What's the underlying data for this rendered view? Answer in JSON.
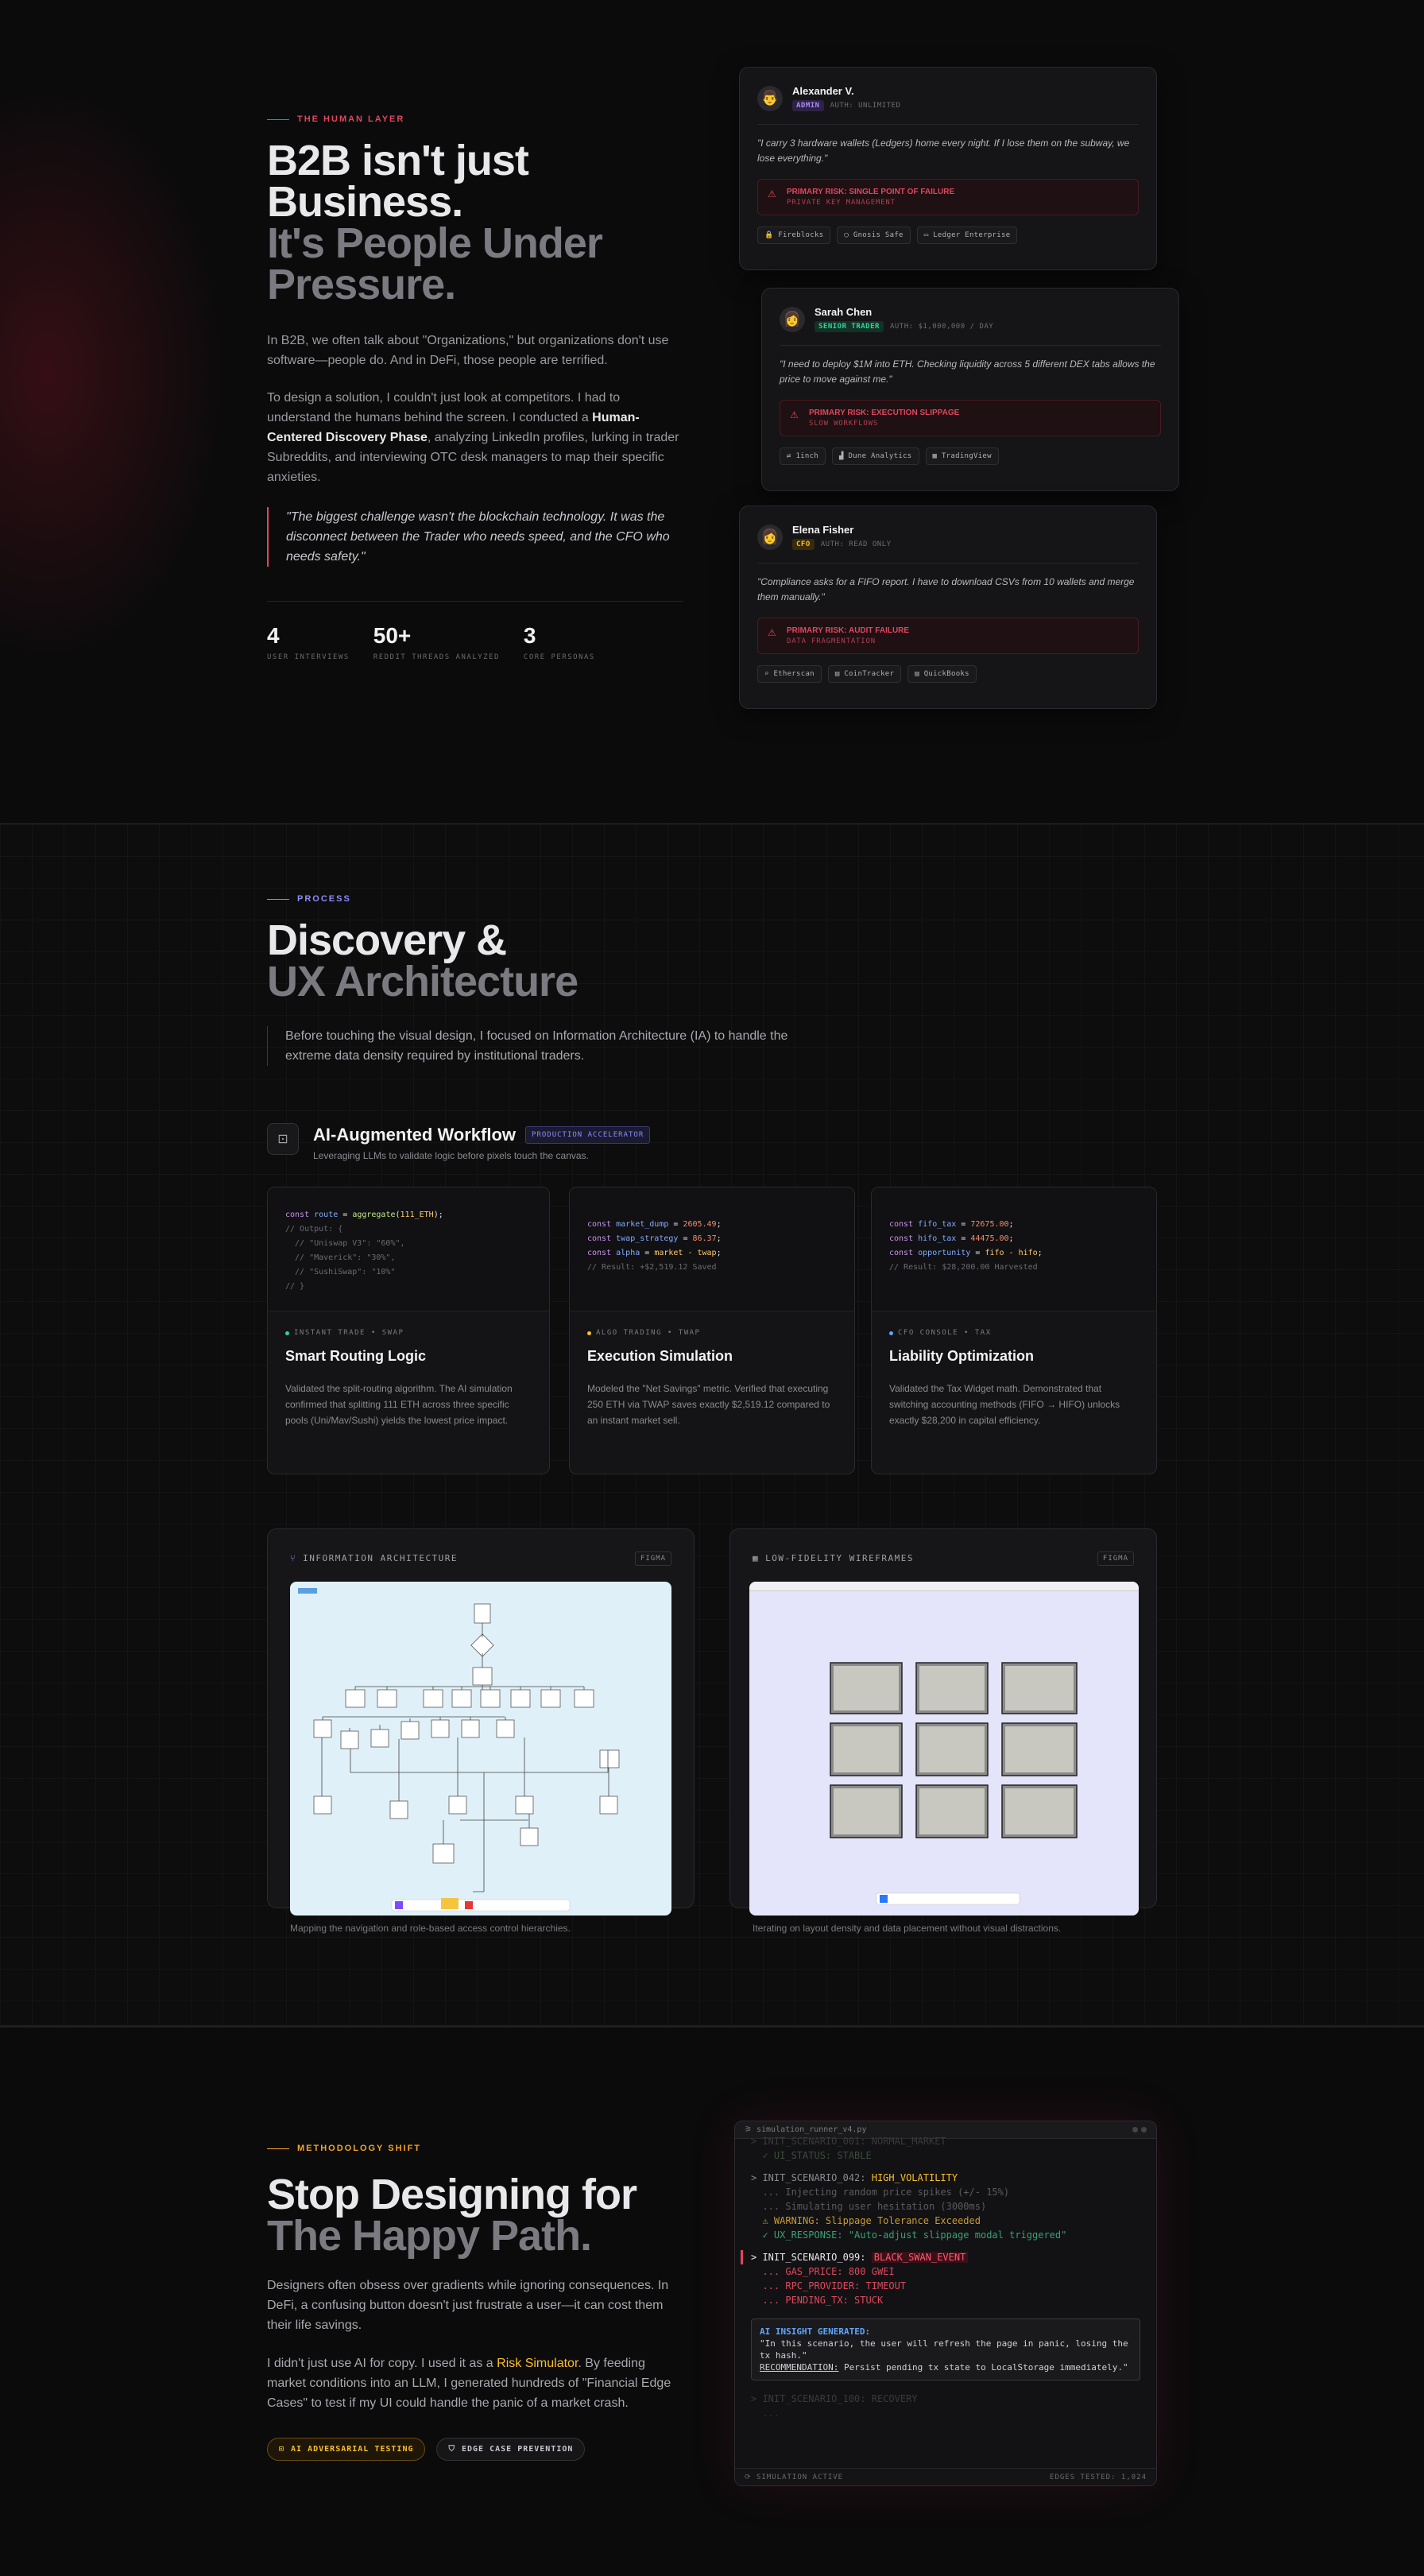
{
  "human_layer": {
    "eyebrow": "THE HUMAN LAYER",
    "title_line1": "B2B isn't just",
    "title_line2": "Business.",
    "title_line3": "It's People Under",
    "title_line4": "Pressure.",
    "para1": "In B2B, we often talk about \"Organizations,\" but organizations don't use software—people do. And in DeFi, those people are terrified.",
    "para2_a": "To design a solution, I couldn't just look at competitors. I had to understand the humans behind the screen. I conducted a ",
    "para2_b": "Human-Centered Discovery Phase",
    "para2_c": ", analyzing LinkedIn profiles, lurking in trader Subreddits, and interviewing OTC desk managers to map their specific anxieties.",
    "quote": "\"The biggest challenge wasn't the blockchain technology. It was the disconnect between the Trader who needs speed, and the CFO who needs safety.\"",
    "stats": [
      {
        "value": "4",
        "label": "USER INTERVIEWS"
      },
      {
        "value": "50+",
        "label": "REDDIT THREADS ANALYZED"
      },
      {
        "value": "3",
        "label": "CORE PERSONAS"
      }
    ],
    "personas": [
      {
        "name": "Alexander V.",
        "role": "ADMIN",
        "auth": "AUTH: UNLIMITED",
        "quote": "\"I carry 3 hardware wallets (Ledgers) home every night. If I lose them on the subway, we lose everything.\"",
        "risk": "PRIMARY RISK: SINGLE POINT OF FAILURE",
        "risk_sub": "PRIVATE KEY MANAGEMENT",
        "tools": [
          "Fireblocks",
          "Gnosis Safe",
          "Ledger Enterprise"
        ],
        "role_color": "#a78bfa"
      },
      {
        "name": "Sarah Chen",
        "role": "SENIOR TRADER",
        "auth": "AUTH: $1,000,000 / DAY",
        "quote": "\"I need to deploy $1M into ETH. Checking liquidity across 5 different DEX tabs allows the price to move against me.\"",
        "risk": "PRIMARY RISK: EXECUTION SLIPPAGE",
        "risk_sub": "SLOW WORKFLOWS",
        "tools": [
          "1inch",
          "Dune Analytics",
          "TradingView"
        ],
        "role_color": "#34d399"
      },
      {
        "name": "Elena Fisher",
        "role": "CFO",
        "auth": "AUTH: READ ONLY",
        "quote": "\"Compliance asks for a FIFO report. I have to download CSVs from 10 wallets and merge them manually.\"",
        "risk": "PRIMARY RISK: AUDIT FAILURE",
        "risk_sub": "DATA FRAGMENTATION",
        "tools": [
          "Etherscan",
          "CoinTracker",
          "QuickBooks"
        ],
        "role_color": "#fbbf24"
      }
    ]
  },
  "process": {
    "eyebrow": "PROCESS",
    "title_line1": "Discovery &",
    "title_line2": "UX Architecture",
    "intro": "Before touching the visual design, I focused on Information Architecture (IA) to handle the extreme data density required by institutional traders.",
    "workflow_title": "AI-Augmented Workflow",
    "workflow_badge": "PRODUCTION ACCELERATOR",
    "workflow_sub": "Leveraging LLMs to validate logic before pixels touch the canvas.",
    "cards": [
      {
        "label": "INSTANT TRADE • SWAP",
        "title": "Smart Routing Logic",
        "desc": "Validated the split-routing algorithm. The AI simulation confirmed that splitting 111 ETH across three specific pools (Uni/Mav/Sushi) yields the lowest price impact.",
        "dot": "#34d399"
      },
      {
        "label": "ALGO TRADING • TWAP",
        "title": "Execution Simulation",
        "desc": "Modeled the \"Net Savings\" metric. Verified that executing 250 ETH via TWAP saves exactly $2,519.12 compared to an instant market sell.",
        "dot": "#fbbf24"
      },
      {
        "label": "CFO CONSOLE • TAX",
        "title": "Liability Optimization",
        "desc": "Validated the Tax Widget math. Demonstrated that switching accounting methods (FIFO → HIFO) unlocks exactly $28,200 in capital efficiency.",
        "dot": "#60a5fa"
      }
    ],
    "ia_title": "INFORMATION ARCHITECTURE",
    "ia_caption": "Mapping the navigation and role-based access control hierarchies.",
    "wf_title": "LOW-FIDELITY WIREFRAMES",
    "wf_caption": "Iterating on layout density and data placement without visual distractions.",
    "figma": "FIGMA"
  },
  "methodology": {
    "eyebrow": "METHODOLOGY SHIFT",
    "title_line1": "Stop Designing for",
    "title_line2": "The Happy Path.",
    "para1": "Designers often obsess over gradients while ignoring consequences. In DeFi, a confusing button doesn't just frustrate a user—it can cost them their life savings.",
    "para2_a": "I didn't just use AI for copy. I used it as a ",
    "para2_b": "Risk Simulator",
    "para2_c": ". By feeding market conditions into an LLM, I generated hundreds of \"Financial Edge Cases\" to test if my UI could handle the panic of a market crash.",
    "pill1": "AI ADVERSARIAL TESTING",
    "pill2": "EDGE CASE PREVENTION",
    "terminal": {
      "filename": "simulation_runner_v4.py",
      "footer_left": "SIMULATION ACTIVE",
      "footer_right": "EDGES TESTED: 1,024",
      "insight_title": "AI INSIGHT GENERATED:",
      "insight_quote": "\"In this scenario, the user will refresh the page in panic, losing the tx hash.\"",
      "insight_rec_label": "RECOMMENDATION:",
      "insight_rec": " Persist pending tx state to LocalStorage immediately.\""
    }
  }
}
